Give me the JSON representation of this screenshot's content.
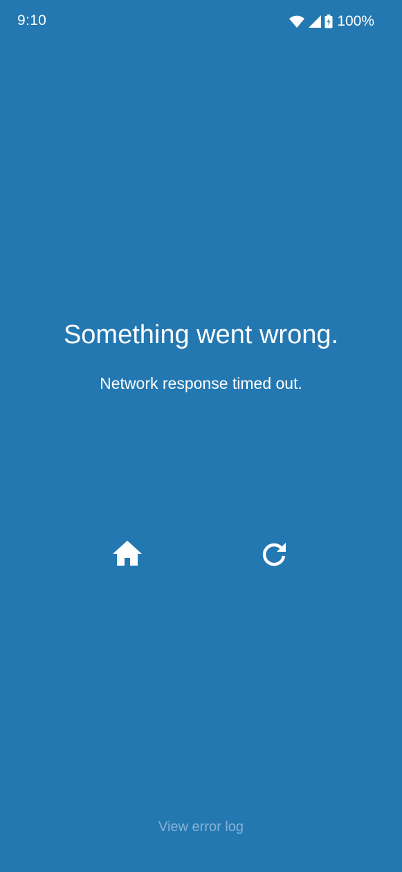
{
  "status_bar": {
    "time": "9:10",
    "battery": "100%",
    "icons": [
      "wifi-icon",
      "cellular-signal-icon",
      "battery-charging-icon"
    ]
  },
  "error": {
    "title": "Something went wrong.",
    "message": "Network response timed out."
  },
  "actions": {
    "home_icon": "home-icon",
    "refresh_icon": "refresh-icon"
  },
  "footer": {
    "error_log_label": "View error log"
  },
  "colors": {
    "background": "#2478b1",
    "text": "#ffffff",
    "link": "#86b2d4"
  }
}
